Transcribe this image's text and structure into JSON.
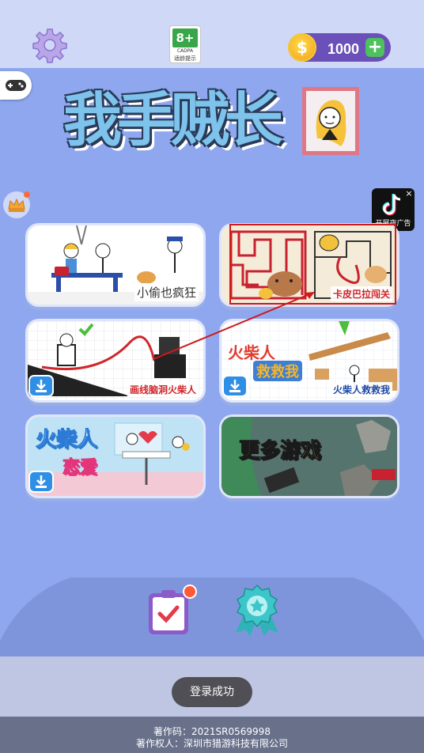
{
  "header": {
    "age_rating": "8+",
    "age_org": "CADPA",
    "age_caption": "适龄提示",
    "coins": "1000",
    "coin_icon": "$",
    "plus_label": "+"
  },
  "title": {
    "text": "我手贼长"
  },
  "ad": {
    "badge": "开屏夜广告",
    "close": "×"
  },
  "games": [
    {
      "label": "小偷也疯狂"
    },
    {
      "label": "卡皮巴拉闯关"
    },
    {
      "label": "画线脑洞火柴人"
    },
    {
      "label": "火柴人救救我",
      "banner1": "火柴人",
      "banner2": "救救我"
    },
    {
      "banner1": "火柴人",
      "banner2": "恋爱"
    },
    {
      "banner": "更多游戏"
    }
  ],
  "toast": "登录成功",
  "footer": {
    "line1": "著作码：2021SR0569998",
    "line2": "著作权人：深圳市猎游科技有限公司"
  },
  "colors": {
    "background": "#8ea7ee",
    "topbar": "#cfd8f7",
    "coin_pill": "#6a50b8",
    "highlight": "#d01a1a"
  }
}
